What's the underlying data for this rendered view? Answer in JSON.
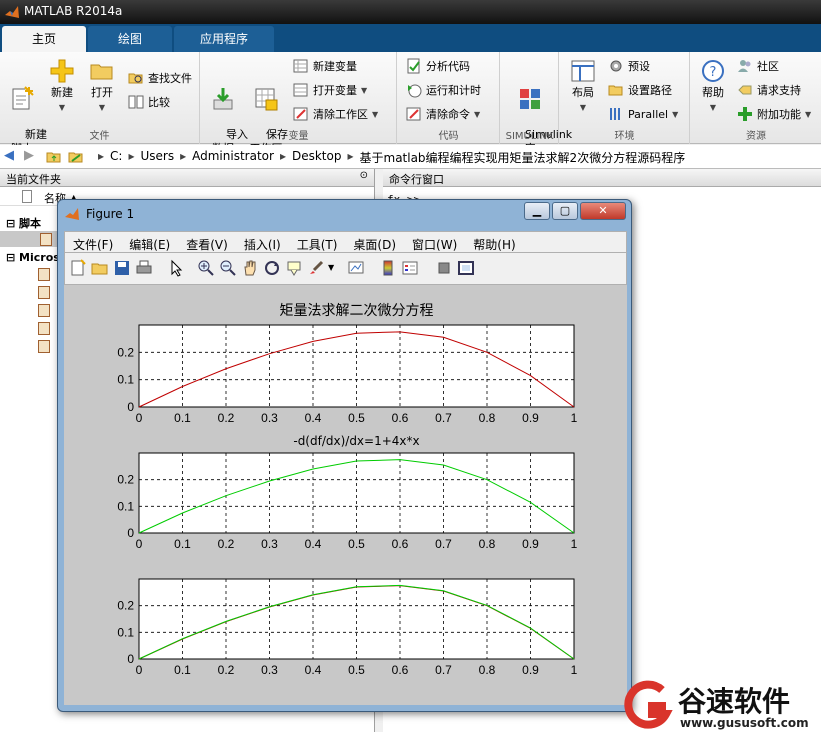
{
  "app": {
    "title": "MATLAB R2014a"
  },
  "tabs": [
    "主页",
    "绘图",
    "应用程序"
  ],
  "ribbon": {
    "file": {
      "new_script": "新建\n脚本",
      "new": "新建",
      "open": "打开",
      "find_files": "查找文件",
      "compare": "比较",
      "label": "文件"
    },
    "variable": {
      "import": "导入\n数据",
      "save_ws": "保存\n工作区",
      "new_var": "新建变量",
      "open_var": "打开变量",
      "clear_ws": "清除工作区",
      "label": "变量"
    },
    "code": {
      "analyze": "分析代码",
      "run_time": "运行和计时",
      "clear_cmd": "清除命令",
      "label": "代码"
    },
    "simulink": {
      "lib": "Simulink\n库",
      "label": "SIMULINK"
    },
    "env": {
      "layout": "布局",
      "prefs": "预设",
      "set_path": "设置路径",
      "parallel": "Parallel",
      "label": "环境"
    },
    "resources": {
      "help": "帮助",
      "community": "社区",
      "support": "请求支持",
      "addons": "附加功能",
      "label": "资源"
    }
  },
  "address": {
    "path": [
      "C:",
      "Users",
      "Administrator",
      "Desktop",
      "基于matlab编程编程实现用矩量法求解2次微分方程源码程序"
    ]
  },
  "left_panel": {
    "title": "当前文件夹",
    "col_name": "名称 ▲",
    "sections": [
      "脚本",
      "Micros"
    ]
  },
  "right_panel": {
    "title": "命令行窗口",
    "prompt": "fx >>"
  },
  "figure": {
    "title": "Figure 1",
    "menu": [
      "文件(F)",
      "编辑(E)",
      "查看(V)",
      "插入(I)",
      "工具(T)",
      "桌面(D)",
      "窗口(W)",
      "帮助(H)"
    ]
  },
  "chart_data": [
    {
      "type": "line",
      "title": "矩量法求解二次微分方程",
      "xlabel": "",
      "ylabel": "",
      "xlim": [
        0,
        1
      ],
      "ylim": [
        0,
        0.3
      ],
      "xticks": [
        "0",
        "0.1",
        "0.2",
        "0.3",
        "0.4",
        "0.5",
        "0.6",
        "0.7",
        "0.8",
        "0.9",
        "1"
      ],
      "yticks": [
        "0",
        "0.1",
        "0.2"
      ],
      "grid": true,
      "series": [
        {
          "color": "#c00000",
          "x": [
            0,
            0.1,
            0.2,
            0.3,
            0.4,
            0.5,
            0.6,
            0.7,
            0.8,
            0.9,
            1
          ],
          "y": [
            0,
            0.075,
            0.14,
            0.195,
            0.24,
            0.27,
            0.275,
            0.255,
            0.2,
            0.115,
            0
          ]
        }
      ]
    },
    {
      "type": "line",
      "title": "-d(df/dx)/dx=1+4x*x",
      "xlabel": "",
      "ylabel": "",
      "xlim": [
        0,
        1
      ],
      "ylim": [
        0,
        0.3
      ],
      "xticks": [
        "0",
        "0.1",
        "0.2",
        "0.3",
        "0.4",
        "0.5",
        "0.6",
        "0.7",
        "0.8",
        "0.9",
        "1"
      ],
      "yticks": [
        "0",
        "0.1",
        "0.2"
      ],
      "grid": true,
      "series": [
        {
          "color": "#00cc00",
          "x": [
            0,
            0.1,
            0.2,
            0.3,
            0.4,
            0.5,
            0.6,
            0.7,
            0.8,
            0.9,
            1
          ],
          "y": [
            0,
            0.075,
            0.14,
            0.195,
            0.24,
            0.27,
            0.275,
            0.255,
            0.2,
            0.115,
            0
          ]
        }
      ]
    },
    {
      "type": "line",
      "title": "",
      "xlabel": "",
      "ylabel": "",
      "xlim": [
        0,
        1
      ],
      "ylim": [
        0,
        0.3
      ],
      "xticks": [
        "0",
        "0.1",
        "0.2",
        "0.3",
        "0.4",
        "0.5",
        "0.6",
        "0.7",
        "0.8",
        "0.9",
        "1"
      ],
      "yticks": [
        "0",
        "0.1",
        "0.2"
      ],
      "grid": true,
      "series": [
        {
          "color": "#c00000",
          "x": [
            0,
            0.1,
            0.2,
            0.3,
            0.4,
            0.5,
            0.6,
            0.7,
            0.8,
            0.9,
            1
          ],
          "y": [
            0,
            0.075,
            0.14,
            0.195,
            0.24,
            0.27,
            0.275,
            0.255,
            0.2,
            0.115,
            0
          ]
        },
        {
          "color": "#00cc00",
          "x": [
            0,
            0.1,
            0.2,
            0.3,
            0.4,
            0.5,
            0.6,
            0.7,
            0.8,
            0.9,
            1
          ],
          "y": [
            0,
            0.076,
            0.141,
            0.196,
            0.241,
            0.271,
            0.276,
            0.256,
            0.201,
            0.116,
            0
          ]
        }
      ]
    }
  ],
  "watermark": {
    "brand": "谷速软件",
    "url": "www.gususoft.com",
    "color": "#d9342b"
  }
}
